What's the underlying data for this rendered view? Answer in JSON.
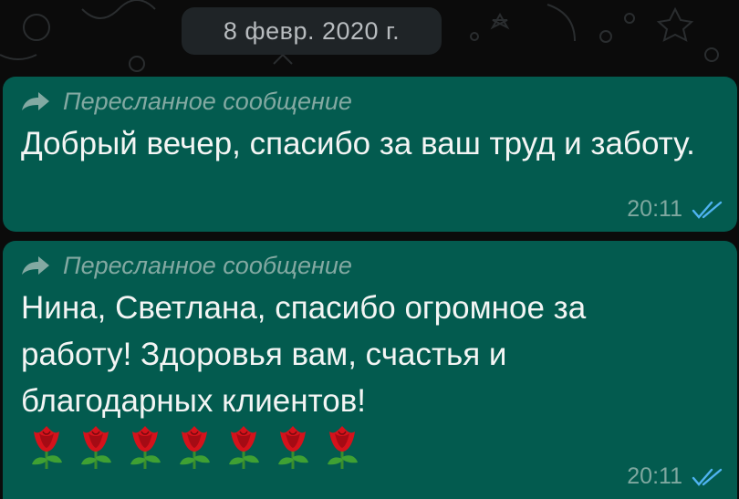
{
  "chat": {
    "date_separator": "8 февр. 2020 г.",
    "messages": [
      {
        "forward_label": "Пересланное сообщение",
        "text": "Добрый вечер, спасибо за ваш труд и заботу.",
        "time": "20:11",
        "status": "read"
      },
      {
        "forward_label": "Пересланное сообщение",
        "text": "Нина, Светлана, спасибо огромное за работу! Здоровья вам, счастья и благодарных клиентов!",
        "emoji": "🌹🌹🌹🌹🌹🌹🌹",
        "time": "20:11",
        "status": "read"
      }
    ]
  },
  "icons": {
    "forward": "forward-arrow-icon",
    "read": "double-check-icon",
    "emoji": "rose-emoji"
  },
  "colors": {
    "background": "#0b0b0b",
    "bubble": "#035b4f",
    "date_pill": "#1f2427",
    "read_ticks": "#4fb3f1"
  }
}
